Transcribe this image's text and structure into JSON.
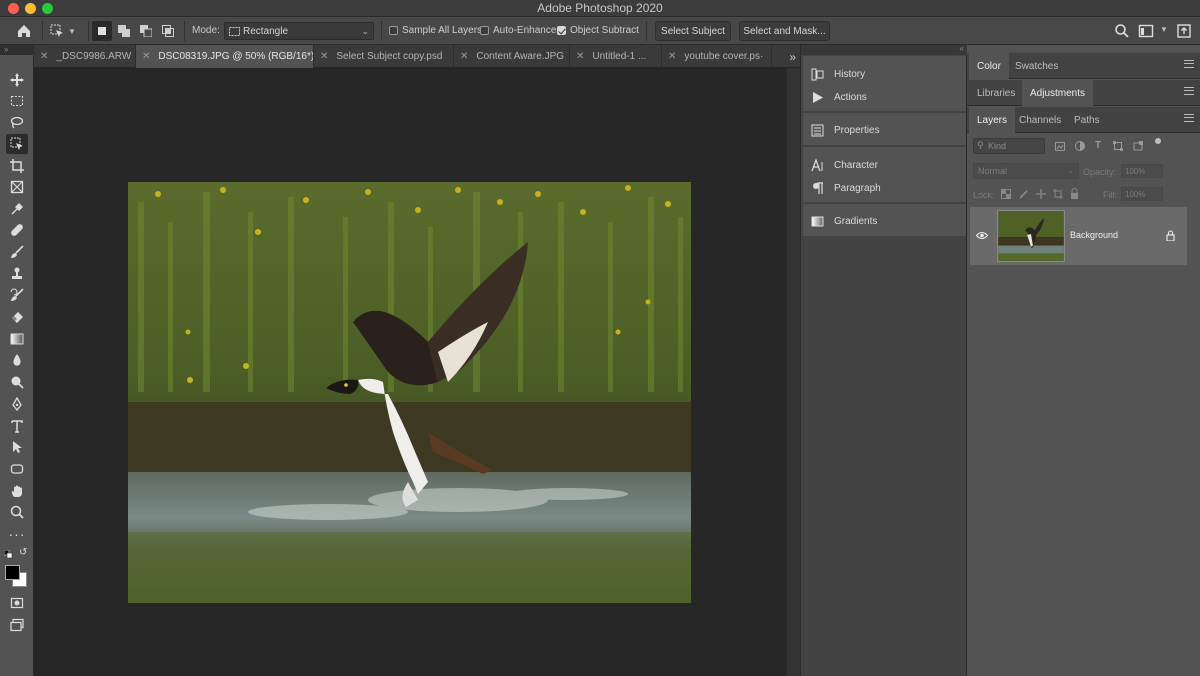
{
  "window": {
    "title": "Adobe Photoshop 2020"
  },
  "options_bar": {
    "mode_label": "Mode:",
    "mode_value": "Rectangle",
    "checkboxes": [
      {
        "label": "Sample All Layers",
        "checked": false
      },
      {
        "label": "Auto-Enhance",
        "checked": false
      },
      {
        "label": "Object Subtract",
        "checked": true
      }
    ],
    "select_subject_label": "Select Subject",
    "select_mask_label": "Select and Mask..."
  },
  "tabs": [
    {
      "label": "_DSC9986.ARW",
      "active": false
    },
    {
      "label": "DSC08319.JPG @ 50% (RGB/16*)",
      "active": true
    },
    {
      "label": "Select Subject copy.psd",
      "active": false
    },
    {
      "label": "Content Aware.JPG",
      "active": false
    },
    {
      "label": "Untitled-1 ...",
      "active": false
    },
    {
      "label": "youtube cover.ps·",
      "active": false
    }
  ],
  "mid_panels": {
    "history": "History",
    "actions": "Actions",
    "properties": "Properties",
    "character": "Character",
    "paragraph": "Paragraph",
    "gradients": "Gradients"
  },
  "right_panels": {
    "group1_tabs": [
      "Color",
      "Swatches"
    ],
    "group2_tabs": [
      "Libraries",
      "Adjustments"
    ],
    "group3_tabs": [
      "Layers",
      "Channels",
      "Paths"
    ],
    "filter_placeholder": "Kind",
    "blend_mode": "Normal",
    "opacity_label": "Opacity:",
    "opacity_value": "100%",
    "lock_label": "Lock:",
    "fill_label": "Fill:",
    "fill_value": "100%",
    "layer_name": "Background"
  },
  "colors": {
    "accent_foreground": "#000000",
    "background_swatch": "#ffffff"
  }
}
